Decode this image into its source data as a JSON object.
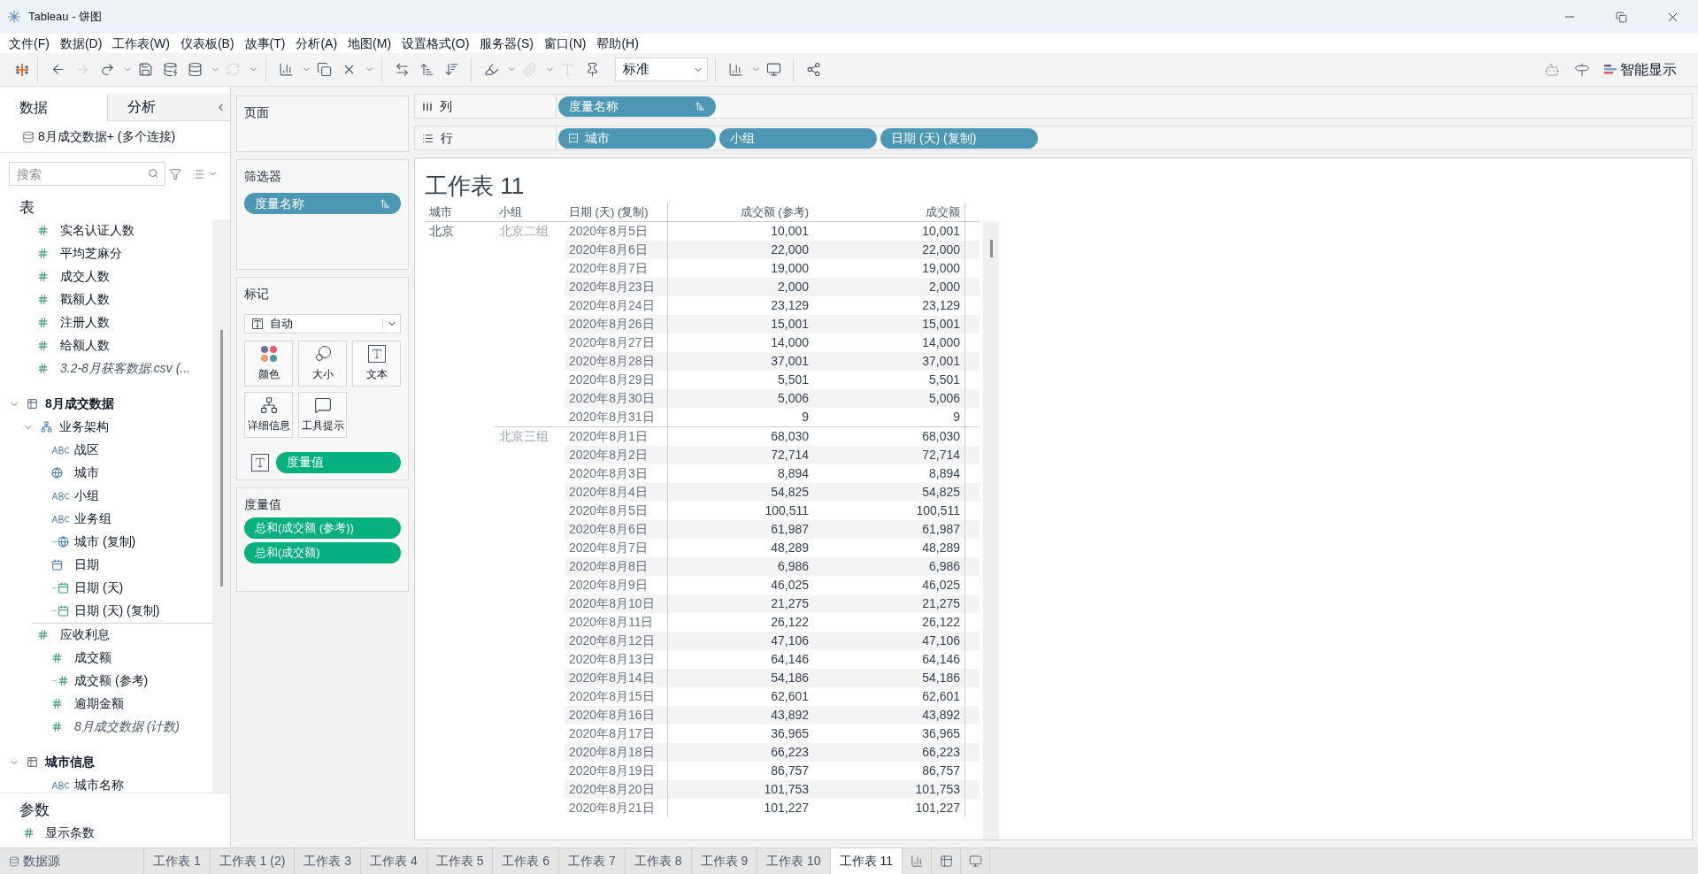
{
  "window": {
    "title": "Tableau - 饼图"
  },
  "menu": [
    "文件(F)",
    "数据(D)",
    "工作表(W)",
    "仪表板(B)",
    "故事(T)",
    "分析(A)",
    "地图(M)",
    "设置格式(O)",
    "服务器(S)",
    "窗口(N)",
    "帮助(H)"
  ],
  "toolbar": {
    "fit_dropdown": "标准",
    "show_me": "智能显示"
  },
  "data_pane": {
    "tabs": [
      {
        "label": "数据",
        "selected": true
      },
      {
        "label": "分析",
        "selected": false
      }
    ],
    "data_source": "8月成交数据+ (多个连接)",
    "search": {
      "placeholder": "搜索"
    },
    "tables_heading": "表",
    "fields": [
      {
        "label": "实名认证人数",
        "kind": "measure"
      },
      {
        "label": "平均芝麻分",
        "kind": "measure"
      },
      {
        "label": "成交人数",
        "kind": "measure"
      },
      {
        "label": "戳额人数",
        "kind": "measure"
      },
      {
        "label": "注册人数",
        "kind": "measure"
      },
      {
        "label": "给额人数",
        "kind": "measure"
      },
      {
        "label": "3.2-8月获客数据.csv (...",
        "kind": "count"
      },
      {
        "label": "8月成交数据",
        "kind": "table",
        "expanded": true,
        "children": [
          {
            "label": "业务架构",
            "kind": "hierarchy",
            "expanded": true,
            "children": [
              {
                "label": "战区",
                "kind": "dimension"
              },
              {
                "label": "城市",
                "kind": "geo"
              },
              {
                "label": "小组",
                "kind": "dimension"
              }
            ]
          },
          {
            "label": "业务组",
            "kind": "dimension"
          },
          {
            "label": "城市 (复制)",
            "kind": "geo-calc"
          },
          {
            "label": "日期",
            "kind": "date"
          },
          {
            "label": "日期 (天)",
            "kind": "date-calc"
          },
          {
            "label": "日期 (天) (复制)",
            "kind": "date-calc"
          },
          {
            "label": "应收利息",
            "kind": "measure"
          },
          {
            "label": "成交额",
            "kind": "measure"
          },
          {
            "label": "成交额 (参考)",
            "kind": "measure-calc"
          },
          {
            "label": "逾期金额",
            "kind": "measure"
          },
          {
            "label": "8月成交数据 (计数)",
            "kind": "count"
          }
        ]
      },
      {
        "label": "城市信息",
        "kind": "table",
        "expanded": true,
        "children": [
          {
            "label": "城市名称",
            "kind": "dimension"
          }
        ]
      }
    ],
    "parameters_heading": "参数",
    "parameters": [
      {
        "label": "显示条数",
        "kind": "measure"
      }
    ]
  },
  "cards": {
    "pages": {
      "heading": "页面"
    },
    "filters": {
      "heading": "筛选器",
      "pills": [
        "度量名称"
      ]
    },
    "marks": {
      "heading": "标记",
      "type": "自动",
      "buttons": [
        {
          "label": "颜色",
          "kind": "color"
        },
        {
          "label": "大小",
          "kind": "size"
        },
        {
          "label": "文本",
          "kind": "text"
        },
        {
          "label": "详细信息",
          "kind": "detail"
        },
        {
          "label": "工具提示",
          "kind": "tooltip"
        }
      ],
      "pills": [
        {
          "label": "度量值",
          "kind": "text"
        }
      ]
    },
    "measure_values": {
      "heading": "度量值",
      "pills": [
        "总和(成交额 (参考))",
        "总和(成交额)"
      ]
    }
  },
  "shelves": [
    {
      "label": "列",
      "kind": "columns",
      "pills": [
        {
          "label": "度量名称",
          "kind": "sort"
        }
      ]
    },
    {
      "label": "行",
      "kind": "rows",
      "pills": [
        {
          "label": "城市",
          "kind": "collapse"
        },
        {
          "label": "小组",
          "kind": "plain"
        },
        {
          "label": "日期 (天) (复制)",
          "kind": "plain"
        }
      ]
    }
  ],
  "sheet": {
    "title": "工作表 11",
    "columns": [
      "城市",
      "小组",
      "日期 (天) (复制)",
      "成交额 (参考)",
      "成交额"
    ],
    "cities": [
      {
        "name": "北京",
        "groups": [
          {
            "name": "北京二组",
            "rows": [
              [
                "2020年8月5日",
                "10,001",
                "10,001"
              ],
              [
                "2020年8月6日",
                "22,000",
                "22,000"
              ],
              [
                "2020年8月7日",
                "19,000",
                "19,000"
              ],
              [
                "2020年8月23日",
                "2,000",
                "2,000"
              ],
              [
                "2020年8月24日",
                "23,129",
                "23,129"
              ],
              [
                "2020年8月26日",
                "15,001",
                "15,001"
              ],
              [
                "2020年8月27日",
                "14,000",
                "14,000"
              ],
              [
                "2020年8月28日",
                "37,001",
                "37,001"
              ],
              [
                "2020年8月29日",
                "5,501",
                "5,501"
              ],
              [
                "2020年8月30日",
                "5,006",
                "5,006"
              ],
              [
                "2020年8月31日",
                "9",
                "9"
              ]
            ]
          },
          {
            "name": "北京三组",
            "rows": [
              [
                "2020年8月1日",
                "68,030",
                "68,030"
              ],
              [
                "2020年8月2日",
                "72,714",
                "72,714"
              ],
              [
                "2020年8月3日",
                "8,894",
                "8,894"
              ],
              [
                "2020年8月4日",
                "54,825",
                "54,825"
              ],
              [
                "2020年8月5日",
                "100,511",
                "100,511"
              ],
              [
                "2020年8月6日",
                "61,987",
                "61,987"
              ],
              [
                "2020年8月7日",
                "48,289",
                "48,289"
              ],
              [
                "2020年8月8日",
                "6,986",
                "6,986"
              ],
              [
                "2020年8月9日",
                "46,025",
                "46,025"
              ],
              [
                "2020年8月10日",
                "21,275",
                "21,275"
              ],
              [
                "2020年8月11日",
                "26,122",
                "26,122"
              ],
              [
                "2020年8月12日",
                "47,106",
                "47,106"
              ],
              [
                "2020年8月13日",
                "64,146",
                "64,146"
              ],
              [
                "2020年8月14日",
                "54,186",
                "54,186"
              ],
              [
                "2020年8月15日",
                "62,601",
                "62,601"
              ],
              [
                "2020年8月16日",
                "43,892",
                "43,892"
              ],
              [
                "2020年8月17日",
                "36,965",
                "36,965"
              ],
              [
                "2020年8月18日",
                "66,223",
                "66,223"
              ],
              [
                "2020年8月19日",
                "86,757",
                "86,757"
              ],
              [
                "2020年8月20日",
                "101,753",
                "101,753"
              ],
              [
                "2020年8月21日",
                "101,227",
                "101,227"
              ]
            ]
          }
        ]
      }
    ]
  },
  "sheet_tabs": [
    {
      "label": "数据源",
      "kind": "datasource",
      "selected": false
    },
    {
      "label": "工作表 1",
      "kind": "sheet",
      "selected": false
    },
    {
      "label": "工作表 1 (2)",
      "kind": "sheet",
      "selected": false
    },
    {
      "label": "工作表 3",
      "kind": "sheet",
      "selected": false
    },
    {
      "label": "工作表 4",
      "kind": "sheet",
      "selected": false
    },
    {
      "label": "工作表 5",
      "kind": "sheet",
      "selected": false
    },
    {
      "label": "工作表 6",
      "kind": "sheet",
      "selected": false
    },
    {
      "label": "工作表 7",
      "kind": "sheet",
      "selected": false
    },
    {
      "label": "工作表 8",
      "kind": "sheet",
      "selected": false
    },
    {
      "label": "工作表 9",
      "kind": "sheet",
      "selected": false
    },
    {
      "label": "工作表 10",
      "kind": "sheet",
      "selected": false
    },
    {
      "label": "工作表 11",
      "kind": "sheet",
      "selected": true
    }
  ]
}
